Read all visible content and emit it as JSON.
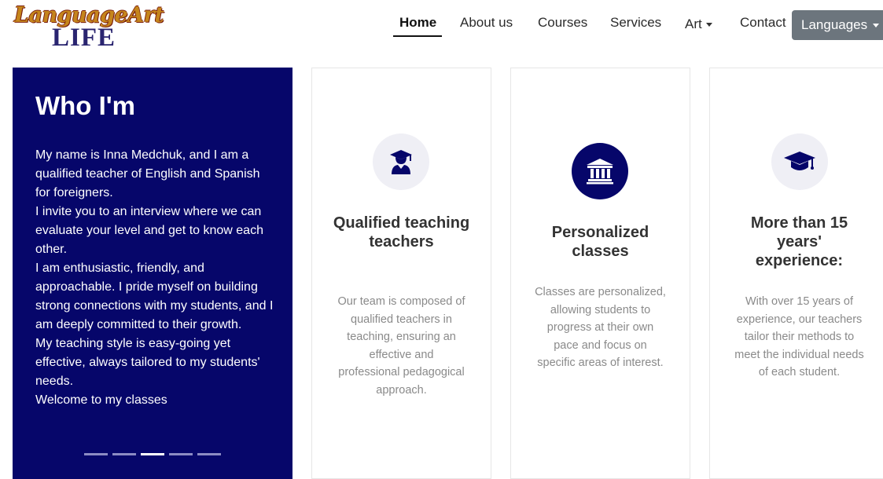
{
  "logo": {
    "line1": "LanguageArt",
    "line2": "LIFE"
  },
  "nav": {
    "items": [
      {
        "label": "Home",
        "active": true
      },
      {
        "label": "About us"
      },
      {
        "label": "Courses"
      },
      {
        "label": "Services"
      },
      {
        "label": "Art",
        "dropdown": true
      },
      {
        "label": "Contact"
      }
    ],
    "languages_label": "Languages"
  },
  "who": {
    "title": "Who I'm",
    "paragraphs": [
      "My name is Inna Medchuk, and I am a qualified teacher of English and Spanish for foreigners.",
      "I invite you to an interview where we can evaluate your level and get to know each other.",
      "I am enthusiastic, friendly, and approachable. I pride myself on building strong connections with my students, and I am deeply committed to their growth.",
      "My teaching style is easy-going yet effective, always tailored to my students' needs.",
      "Welcome to my classes"
    ],
    "slides": 5,
    "active_slide": 3
  },
  "cards": [
    {
      "icon": "graduate-icon",
      "title": "Qualified teaching teachers",
      "text": "Our team is composed of qualified teachers in teaching, ensuring an effective and professional pedagogical approach."
    },
    {
      "icon": "institution-icon",
      "title": "Personalized classes",
      "text": "Classes are personalized, allowing students to progress at their own pace and focus on specific areas of interest."
    },
    {
      "icon": "graduation-cap-icon",
      "title": "More than 15 years' experience:",
      "text": "With over 15 years of experience, our teachers tailor their methods to meet the individual needs of each student."
    }
  ],
  "colors": {
    "navy": "#06066a",
    "logo_orange": "#c5851c",
    "logo_blue": "#2a2570",
    "button_gray": "#6c757d",
    "card_text": "#8a8a8a"
  }
}
